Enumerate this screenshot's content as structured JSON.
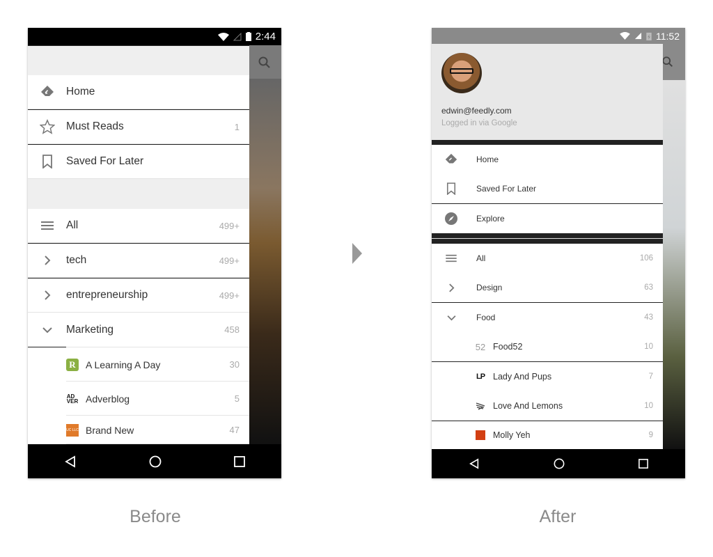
{
  "captions": {
    "before": "Before",
    "after": "After"
  },
  "colors": {
    "accent_logo_green": "#8bb043",
    "brand_new_orange": "#e07a2a",
    "molly_red": "#d23f12"
  },
  "before": {
    "status_time": "2:44",
    "nav": [
      {
        "label": "Home",
        "icon": "feedly-icon",
        "count": ""
      },
      {
        "label": "Must Reads",
        "icon": "star-icon",
        "count": "1"
      },
      {
        "label": "Saved For Later",
        "icon": "bookmark-icon",
        "count": ""
      }
    ],
    "categories": [
      {
        "label": "All",
        "icon": "menu-icon",
        "count": "499+"
      },
      {
        "label": "tech",
        "icon": "chevron-right-icon",
        "count": "499+"
      },
      {
        "label": "entrepreneurship",
        "icon": "chevron-right-icon",
        "count": "499+"
      },
      {
        "label": "Marketing",
        "icon": "chevron-down-icon",
        "count": "458"
      }
    ],
    "feeds": [
      {
        "label": "A Learning A Day",
        "icon": "R",
        "count": "30"
      },
      {
        "label": "Adverblog",
        "icon": "ADVER",
        "count": "5"
      },
      {
        "label": "Brand New",
        "icon": "UC LLC",
        "count": "47"
      }
    ]
  },
  "after": {
    "status_time": "11:52",
    "profile": {
      "email": "edwin@feedly.com",
      "subtitle": "Logged in via Google"
    },
    "nav": [
      {
        "label": "Home",
        "icon": "feedly-icon"
      },
      {
        "label": "Saved For Later",
        "icon": "bookmark-icon"
      },
      {
        "label": "Explore",
        "icon": "compass-icon"
      }
    ],
    "categories": [
      {
        "label": "All",
        "icon": "menu-icon",
        "count": "106"
      },
      {
        "label": "Design",
        "icon": "chevron-right-icon",
        "count": "63"
      },
      {
        "label": "Food",
        "icon": "chevron-down-icon",
        "count": "43"
      }
    ],
    "feeds": [
      {
        "label": "Food52",
        "icon": "52",
        "count": "10"
      },
      {
        "label": "Lady And Pups",
        "icon": "LP",
        "count": "7"
      },
      {
        "label": "Love And Lemons",
        "icon": "lemons-logo",
        "count": "10"
      },
      {
        "label": "Molly Yeh",
        "icon": "red-square",
        "count": "9"
      }
    ]
  }
}
